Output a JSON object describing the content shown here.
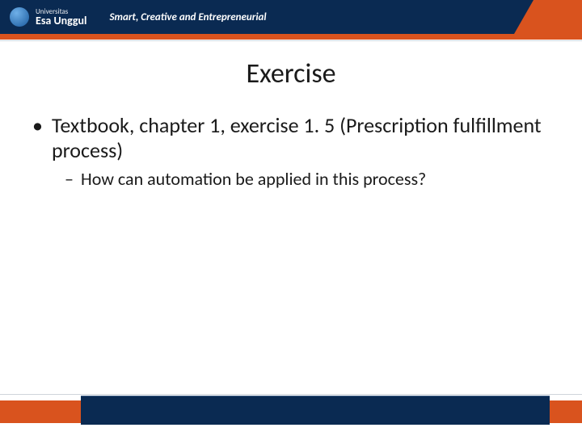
{
  "header": {
    "logo_top": "Universitas",
    "logo_name": "Esa Unggul",
    "tagline": "Smart, Creative and Entrepreneurial"
  },
  "slide": {
    "title": "Exercise",
    "bullet1": "Textbook, chapter 1, exercise 1. 5 (Prescription fulfillment process)",
    "bullet2": "How can automation be applied in this process?"
  }
}
